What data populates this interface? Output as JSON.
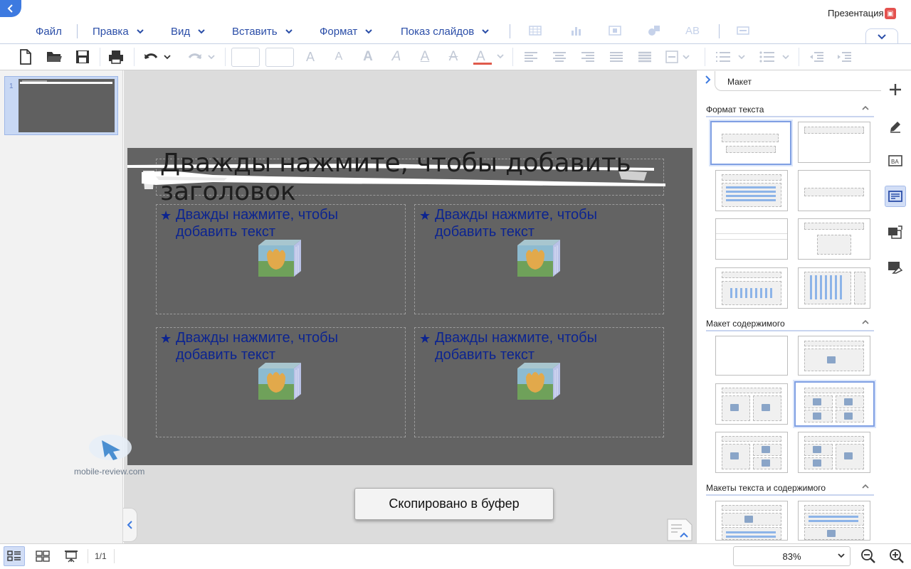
{
  "app": {
    "document_title": "Презентация"
  },
  "menu": {
    "file": "Файл",
    "edit": "Правка",
    "view": "Вид",
    "insert": "Вставить",
    "format": "Формат",
    "slideshow": "Показ слайдов"
  },
  "slides": {
    "thumbnail_number": "1",
    "page_count": "1/1"
  },
  "slide": {
    "title_placeholder": "Дважды нажмите, чтобы добавить заголовок",
    "content_placeholders": [
      {
        "line1": "Дважды нажмите, чтобы",
        "line2": "добавить текст"
      },
      {
        "line1": "Дважды нажмите, чтобы",
        "line2": "добавить текст"
      },
      {
        "line1": "Дважды нажмите, чтобы",
        "line2": "добавить текст"
      },
      {
        "line1": "Дважды нажмите, чтобы",
        "line2": "добавить текст"
      }
    ],
    "bullet": "★"
  },
  "toast": {
    "text": "Скопировано в буфер"
  },
  "watermark": {
    "text": "mobile-review.com"
  },
  "right_panel": {
    "tab_label": "Макет",
    "sections": {
      "text_format": "Формат текста",
      "content_layout": "Макет содержимого",
      "text_content_layouts": "Макеты текста и содержимого"
    }
  },
  "zoom": {
    "value": "83%"
  },
  "colors": {
    "accent": "#2b4ea8",
    "slide_bg": "#636363",
    "placeholder_text": "#0c2490",
    "selection": "#c8d8f4"
  },
  "icons": [
    "back-icon",
    "presentation-icon",
    "table-icon",
    "chart-icon",
    "image-icon",
    "shapes-icon",
    "text-art-icon",
    "textbox-icon",
    "new-file-icon",
    "open-folder-icon",
    "save-icon",
    "print-icon",
    "undo-icon",
    "redo-icon",
    "plus-icon",
    "pencil-icon",
    "text-image-icon",
    "layout-icon",
    "transition-icon",
    "notes-icon",
    "outline-view-icon",
    "slide-sorter-icon",
    "slideshow-icon",
    "zoom-out-icon",
    "zoom-in-icon"
  ]
}
